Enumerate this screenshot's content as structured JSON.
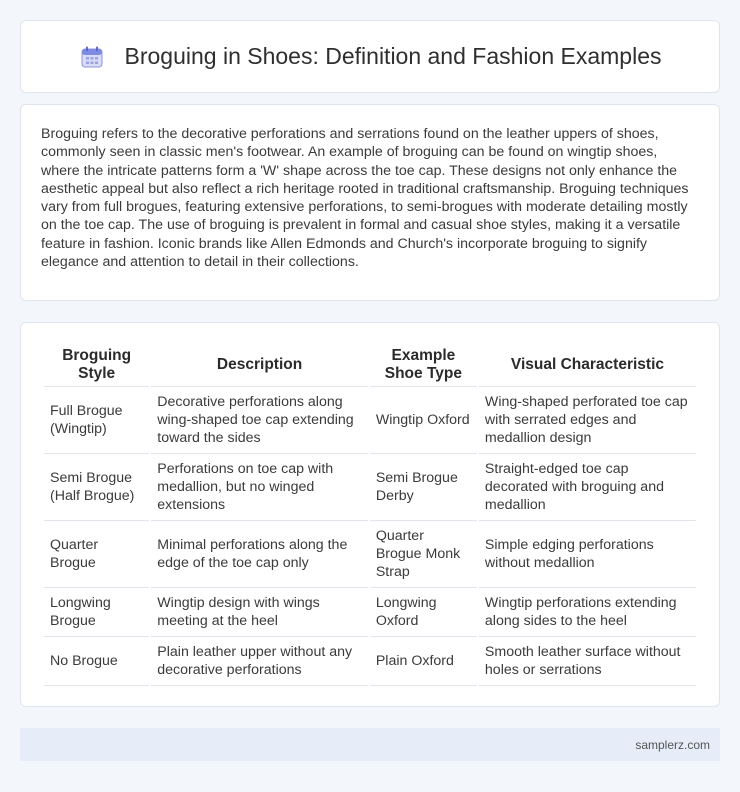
{
  "header": {
    "icon": "calendar-icon",
    "title": "Broguing in Shoes: Definition and Fashion Examples"
  },
  "intro": {
    "text": "Broguing refers to the decorative perforations and serrations found on the leather uppers of shoes, commonly seen in classic men's footwear. An example of broguing can be found on wingtip shoes, where the intricate patterns form a 'W' shape across the toe cap. These designs not only enhance the aesthetic appeal but also reflect a rich heritage rooted in traditional craftsmanship. Broguing techniques vary from full brogues, featuring extensive perforations, to semi-brogues with moderate detailing mostly on the toe cap. The use of broguing is prevalent in formal and casual shoe styles, making it a versatile feature in fashion. Iconic brands like Allen Edmonds and Church's incorporate broguing to signify elegance and attention to detail in their collections."
  },
  "table": {
    "headers": [
      "Broguing Style",
      "Description",
      "Example Shoe Type",
      "Visual Characteristic"
    ],
    "rows": [
      [
        "Full Brogue (Wingtip)",
        "Decorative perforations along wing-shaped toe cap extending toward the sides",
        "Wingtip Oxford",
        "Wing-shaped perforated toe cap with serrated edges and medallion design"
      ],
      [
        "Semi Brogue (Half Brogue)",
        "Perforations on toe cap with medallion, but no winged extensions",
        "Semi Brogue Derby",
        "Straight-edged toe cap decorated with broguing and medallion"
      ],
      [
        "Quarter Brogue",
        "Minimal perforations along the edge of the toe cap only",
        "Quarter Brogue Monk Strap",
        "Simple edging perforations without medallion"
      ],
      [
        "Longwing Brogue",
        "Wingtip design with wings meeting at the heel",
        "Longwing Oxford",
        "Wingtip perforations extending along sides to the heel"
      ],
      [
        "No Brogue",
        "Plain leather upper without any decorative perforations",
        "Plain Oxford",
        "Smooth leather surface without holes or serrations"
      ]
    ]
  },
  "footer": {
    "site": "samplerz.com"
  }
}
